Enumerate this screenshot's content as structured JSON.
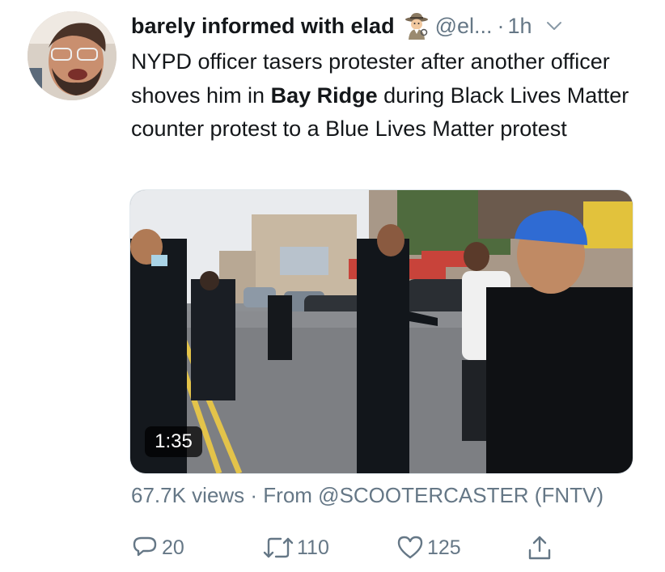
{
  "tweet": {
    "display_name": "barely informed with elad",
    "display_name_emoji": "detective-emoji",
    "handle": "@el...",
    "separator": "·",
    "time": "1h",
    "text_parts": [
      {
        "text": "NYPD officer tasers protester after another officer shoves him in ",
        "bold": false
      },
      {
        "text": "Bay Ridge",
        "bold": true
      },
      {
        "text": " during Black Lives Matter counter protest to a Blue Lives Matter protest",
        "bold": false
      }
    ],
    "media": {
      "type": "video",
      "duration": "1:35"
    },
    "meta": "67.7K views · From @SCOOTERCASTER (FNTV)"
  },
  "actions": {
    "reply_count": "20",
    "retweet_count": "110",
    "like_count": "125"
  },
  "colors": {
    "text_primary": "#14171a",
    "text_secondary": "#657786",
    "border": "#e1e8ed"
  },
  "icons": [
    "chevron-down-icon",
    "reply-icon",
    "retweet-icon",
    "like-icon",
    "share-icon"
  ]
}
